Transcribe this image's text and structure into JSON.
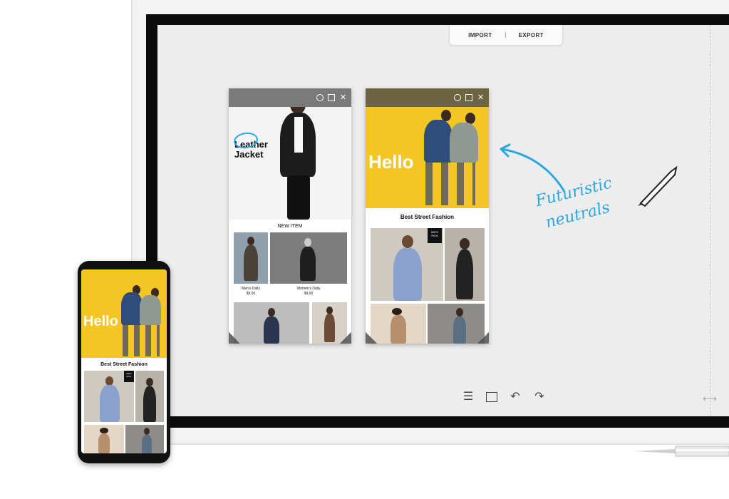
{
  "board": {
    "import_label": "IMPORT",
    "export_label": "EXPORT"
  },
  "window_left": {
    "title_text_1": "Leather",
    "title_text_2": "Jacket",
    "section_label": "NEW ITEM",
    "items": [
      {
        "name": "Men's Daily",
        "price": "$9.00"
      },
      {
        "name": "Women's Daily",
        "price": "$9.00"
      }
    ]
  },
  "window_right": {
    "hero_text": "Hello",
    "section_label": "Best Street Fashion",
    "badge": "MD'S\nPICK"
  },
  "handwriting": {
    "line1": "Futuristic",
    "line2": "neutrals"
  },
  "phone": {
    "hero_text": "Hello",
    "section_label": "Best Street Fashion",
    "badge": "MD'S\nPICK"
  },
  "colors": {
    "accent_yellow": "#f3c623",
    "hand_blue": "#2aa7e0",
    "titlebar_gray": "#7a7a7a",
    "titlebar_olive": "#6d6441"
  },
  "icons": [
    "menu-icon",
    "frame-icon",
    "undo-icon",
    "redo-icon",
    "expand-icon",
    "rotate-icon",
    "maximize-icon",
    "close-icon"
  ]
}
